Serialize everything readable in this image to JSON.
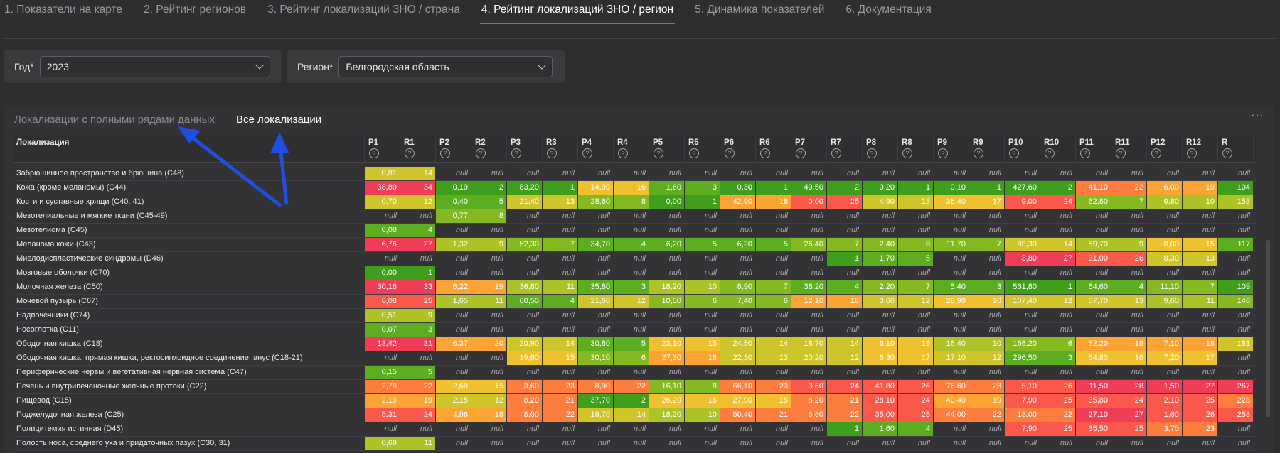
{
  "tabs": [
    "1. Показатели на карте",
    "2. Рейтинг регионов",
    "3. Рейтинг локализаций ЗНО / страна",
    "4. Рейтинг локализаций ЗНО / регион",
    "5. Динамика показателей",
    "6. Документация"
  ],
  "active_tab": 3,
  "filters": {
    "year_label": "Год*",
    "year_value": "2023",
    "region_label": "Регион*",
    "region_value": "Белгородская область"
  },
  "panel": {
    "tab1": "Локализации с полными рядами данных",
    "tab2": "Все локализации",
    "more": "···"
  },
  "table": {
    "name_header": "Локализация",
    "columns": [
      "P1",
      "R1",
      "P2",
      "R2",
      "P3",
      "R3",
      "P4",
      "R4",
      "P5",
      "R5",
      "P6",
      "R6",
      "P7",
      "R7",
      "P8",
      "R8",
      "P9",
      "R9",
      "P10",
      "R10",
      "P11",
      "R11",
      "P12",
      "R12",
      "R"
    ],
    "help_glyph": "?",
    "rows": [
      {
        "name": "Забрюшинное пространство и брюшина (C48)",
        "v": [
          "0,81",
          "14",
          "null",
          "null",
          "null",
          "null",
          "null",
          "null",
          "null",
          "null",
          "null",
          "null",
          "null",
          "null",
          "null",
          "null",
          "null",
          "null",
          "null",
          "null",
          "null",
          "null",
          "null",
          "null",
          "null"
        ]
      },
      {
        "name": "Кожа (кроме меланомы) (C44)",
        "v": [
          "38,89",
          "34",
          "0,19",
          "2",
          "83,20",
          "1",
          "14,90",
          "16",
          "1,60",
          "3",
          "0,30",
          "1",
          "49,50",
          "2",
          "0,20",
          "1",
          "0,10",
          "1",
          "427,60",
          "2",
          "41,10",
          "22",
          "6,00",
          "19",
          "104"
        ]
      },
      {
        "name": "Кости и суставные хрящи (C40, 41)",
        "v": [
          "0,70",
          "12",
          "0,40",
          "5",
          "21,40",
          "13",
          "28,60",
          "8",
          "0,00",
          "1",
          "42,90",
          "18",
          "0,00",
          "25",
          "4,90",
          "13",
          "36,40",
          "17",
          "9,00",
          "24",
          "62,80",
          "7",
          "9,80",
          "10",
          "153"
        ]
      },
      {
        "name": "Мезотелиальные и мягкие ткани (C45-49)",
        "v": [
          "null",
          "null",
          "0,77",
          "8",
          "null",
          "null",
          "null",
          "null",
          "null",
          "null",
          "null",
          "null",
          "null",
          "null",
          "null",
          "null",
          "null",
          "null",
          "null",
          "null",
          "null",
          "null",
          "null",
          "null",
          "null"
        ]
      },
      {
        "name": "Мезотелиома (C45)",
        "v": [
          "0,08",
          "4",
          "null",
          "null",
          "null",
          "null",
          "null",
          "null",
          "null",
          "null",
          "null",
          "null",
          "null",
          "null",
          "null",
          "null",
          "null",
          "null",
          "null",
          "null",
          "null",
          "null",
          "null",
          "null",
          "null"
        ]
      },
      {
        "name": "Меланома кожи (C43)",
        "v": [
          "6,76",
          "27",
          "1,32",
          "9",
          "52,30",
          "7",
          "34,70",
          "4",
          "6,20",
          "5",
          "6,20",
          "5",
          "26,40",
          "7",
          "2,40",
          "8",
          "11,70",
          "7",
          "89,30",
          "14",
          "59,70",
          "9",
          "8,00",
          "15",
          "117"
        ]
      },
      {
        "name": "Миелодиспластические синдромы (D46)",
        "v": [
          "null",
          "null",
          "null",
          "null",
          "null",
          "null",
          "null",
          "null",
          "null",
          "null",
          "null",
          "null",
          "null",
          "1",
          "1,70",
          "5",
          "null",
          "null",
          "3,80",
          "27",
          "31,00",
          "26",
          "8,30",
          "13",
          "null"
        ]
      },
      {
        "name": "Мозговые оболочки (C70)",
        "v": [
          "0,00",
          "1",
          "null",
          "null",
          "null",
          "null",
          "null",
          "null",
          "null",
          "null",
          "null",
          "null",
          "null",
          "null",
          "null",
          "null",
          "null",
          "null",
          "null",
          "null",
          "null",
          "null",
          "null",
          "null",
          "null"
        ]
      },
      {
        "name": "Молочная железа (C50)",
        "v": [
          "30,16",
          "33",
          "6,22",
          "19",
          "36,80",
          "11",
          "35,80",
          "3",
          "18,20",
          "10",
          "8,90",
          "7",
          "38,20",
          "4",
          "2,20",
          "7",
          "5,40",
          "3",
          "561,80",
          "1",
          "64,60",
          "4",
          "11,10",
          "7",
          "109"
        ]
      },
      {
        "name": "Мочевой пузырь (C67)",
        "v": [
          "6,08",
          "25",
          "1,65",
          "11",
          "60,50",
          "4",
          "21,60",
          "12",
          "10,50",
          "6",
          "7,40",
          "6",
          "12,10",
          "18",
          "3,60",
          "12",
          "28,90",
          "16",
          "107,40",
          "12",
          "57,70",
          "13",
          "9,60",
          "11",
          "146"
        ]
      },
      {
        "name": "Надпочечники (C74)",
        "v": [
          "0,51",
          "9",
          "null",
          "null",
          "null",
          "null",
          "null",
          "null",
          "null",
          "null",
          "null",
          "null",
          "null",
          "null",
          "null",
          "null",
          "null",
          "null",
          "null",
          "null",
          "null",
          "null",
          "null",
          "null",
          "null"
        ]
      },
      {
        "name": "Носоглотка (C11)",
        "v": [
          "0,07",
          "3",
          "null",
          "null",
          "null",
          "null",
          "null",
          "null",
          "null",
          "null",
          "null",
          "null",
          "null",
          "null",
          "null",
          "null",
          "null",
          "null",
          "null",
          "null",
          "null",
          "null",
          "null",
          "null",
          "null"
        ]
      },
      {
        "name": "Ободочная кишка (C18)",
        "v": [
          "13,42",
          "31",
          "6,37",
          "20",
          "20,90",
          "14",
          "30,80",
          "5",
          "23,10",
          "15",
          "24,50",
          "14",
          "18,70",
          "14",
          "6,10",
          "16",
          "16,40",
          "10",
          "166,20",
          "6",
          "52,20",
          "18",
          "7,10",
          "18",
          "181"
        ]
      },
      {
        "name": "Ободочная кишка, прямая кишка, ректосигмоидное соединение, анус (C18-21)",
        "v": [
          "null",
          "null",
          "null",
          "null",
          "19,60",
          "15",
          "30,10",
          "6",
          "27,30",
          "18",
          "22,30",
          "13",
          "20,20",
          "12",
          "6,30",
          "17",
          "17,10",
          "12",
          "296,50",
          "3",
          "54,80",
          "16",
          "7,20",
          "17",
          "null"
        ]
      },
      {
        "name": "Периферические нервы и вегетативная нервная система (C47)",
        "v": [
          "0,15",
          "5",
          "null",
          "null",
          "null",
          "null",
          "null",
          "null",
          "null",
          "null",
          "null",
          "null",
          "null",
          "null",
          "null",
          "null",
          "null",
          "null",
          "null",
          "null",
          "null",
          "null",
          "null",
          "null",
          "null"
        ]
      },
      {
        "name": "Печень и внутрипеченочные желчные протоки (C22)",
        "v": [
          "2,78",
          "22",
          "2,68",
          "15",
          "3,60",
          "23",
          "8,90",
          "22",
          "16,10",
          "8",
          "66,10",
          "23",
          "3,60",
          "24",
          "41,80",
          "26",
          "76,60",
          "23",
          "5,10",
          "26",
          "11,50",
          "28",
          "1,50",
          "27",
          "267"
        ]
      },
      {
        "name": "Пищевод (C15)",
        "v": [
          "2,19",
          "19",
          "2,15",
          "12",
          "8,20",
          "21",
          "37,70",
          "2",
          "26,20",
          "16",
          "27,90",
          "15",
          "8,20",
          "21",
          "28,10",
          "24",
          "40,40",
          "19",
          "7,90",
          "25",
          "35,80",
          "24",
          "2,10",
          "25",
          "223"
        ]
      },
      {
        "name": "Поджелудочная железа (C25)",
        "v": [
          "5,31",
          "24",
          "4,96",
          "18",
          "8,00",
          "22",
          "19,70",
          "14",
          "18,20",
          "10",
          "50,40",
          "21",
          "6,60",
          "22",
          "35,00",
          "25",
          "44,00",
          "22",
          "13,00",
          "22",
          "27,10",
          "27",
          "1,60",
          "26",
          "253"
        ]
      },
      {
        "name": "Полицитемия истинная (D45)",
        "v": [
          "null",
          "null",
          "null",
          "null",
          "null",
          "null",
          "null",
          "null",
          "null",
          "null",
          "null",
          "null",
          "null",
          "1",
          "1,60",
          "4",
          "null",
          "null",
          "7,90",
          "25",
          "35,50",
          "25",
          "3,70",
          "23",
          "null"
        ]
      },
      {
        "name": "Полость носа, среднего уха и придаточных пазух (C30, 31)",
        "v": [
          "0,69",
          "11",
          "null",
          "null",
          "null",
          "null",
          "null",
          "null",
          "null",
          "null",
          "null",
          "null",
          "null",
          "null",
          "null",
          "null",
          "null",
          "null",
          "null",
          "null",
          "null",
          "null",
          "null",
          "null",
          "null"
        ]
      }
    ]
  },
  "colors": {
    "accent": "#4b7cf0",
    "rank_palette": [
      "#3f9e1c",
      "#5cad20",
      "#85b922",
      "#acc226",
      "#cfc42a",
      "#f0c12e",
      "#fba333",
      "#fc7d3e",
      "#f9584b",
      "#f03d57"
    ],
    "null_bg": "#333336",
    "annotation_arrow": "#1f4fe0"
  }
}
